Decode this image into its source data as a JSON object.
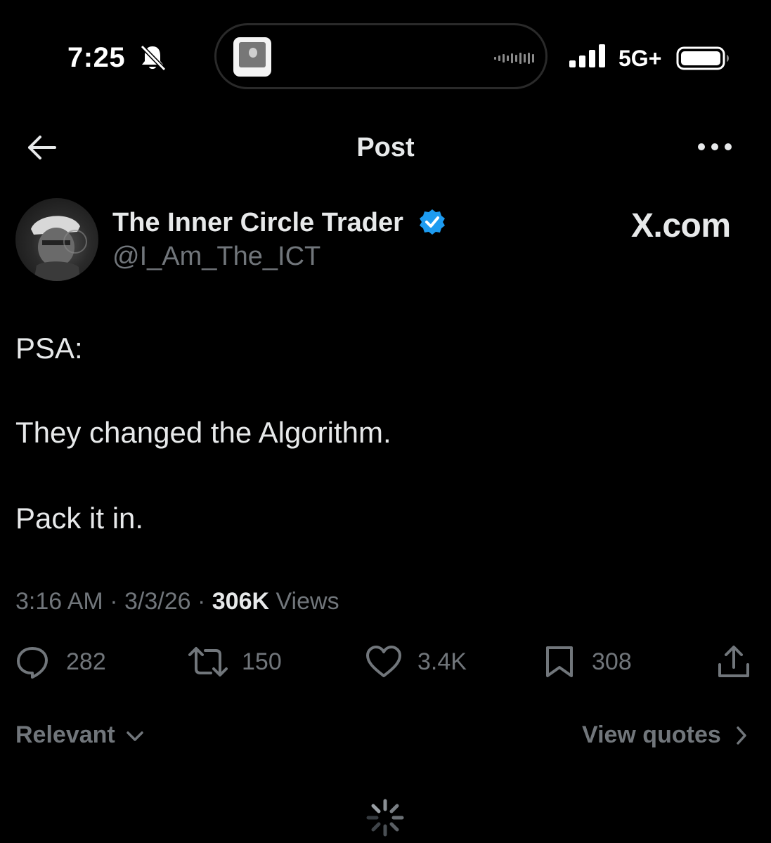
{
  "status_bar": {
    "time": "7:25",
    "network": "5G+",
    "bell_icon": "bell-slash-icon",
    "signal_icon": "cellular-signal-icon",
    "battery_icon": "battery-icon"
  },
  "header": {
    "title": "Post",
    "back_icon": "arrow-left-icon",
    "more_icon": "more-horizontal-icon"
  },
  "author": {
    "display_name": "The Inner Circle Trader",
    "handle": "@I_Am_The_ICT",
    "verified_color": "#1d9bf0",
    "watermark": "X.com"
  },
  "post": {
    "lines": [
      "PSA:",
      "They changed the Algorithm.",
      "Pack it in."
    ]
  },
  "meta": {
    "time": "3:16 AM",
    "sep1": "·",
    "date": "3/3/26",
    "sep2": "·",
    "views_count": "306K",
    "views_label": "Views"
  },
  "actions": {
    "replies": "282",
    "reposts": "150",
    "likes": "3.4K",
    "bookmarks": "308"
  },
  "footer": {
    "sort_label": "Relevant",
    "view_quotes_label": "View quotes"
  },
  "colors": {
    "background": "#000000",
    "text_primary": "#e7e9ea",
    "text_secondary": "#71767b",
    "accent": "#1d9bf0"
  }
}
